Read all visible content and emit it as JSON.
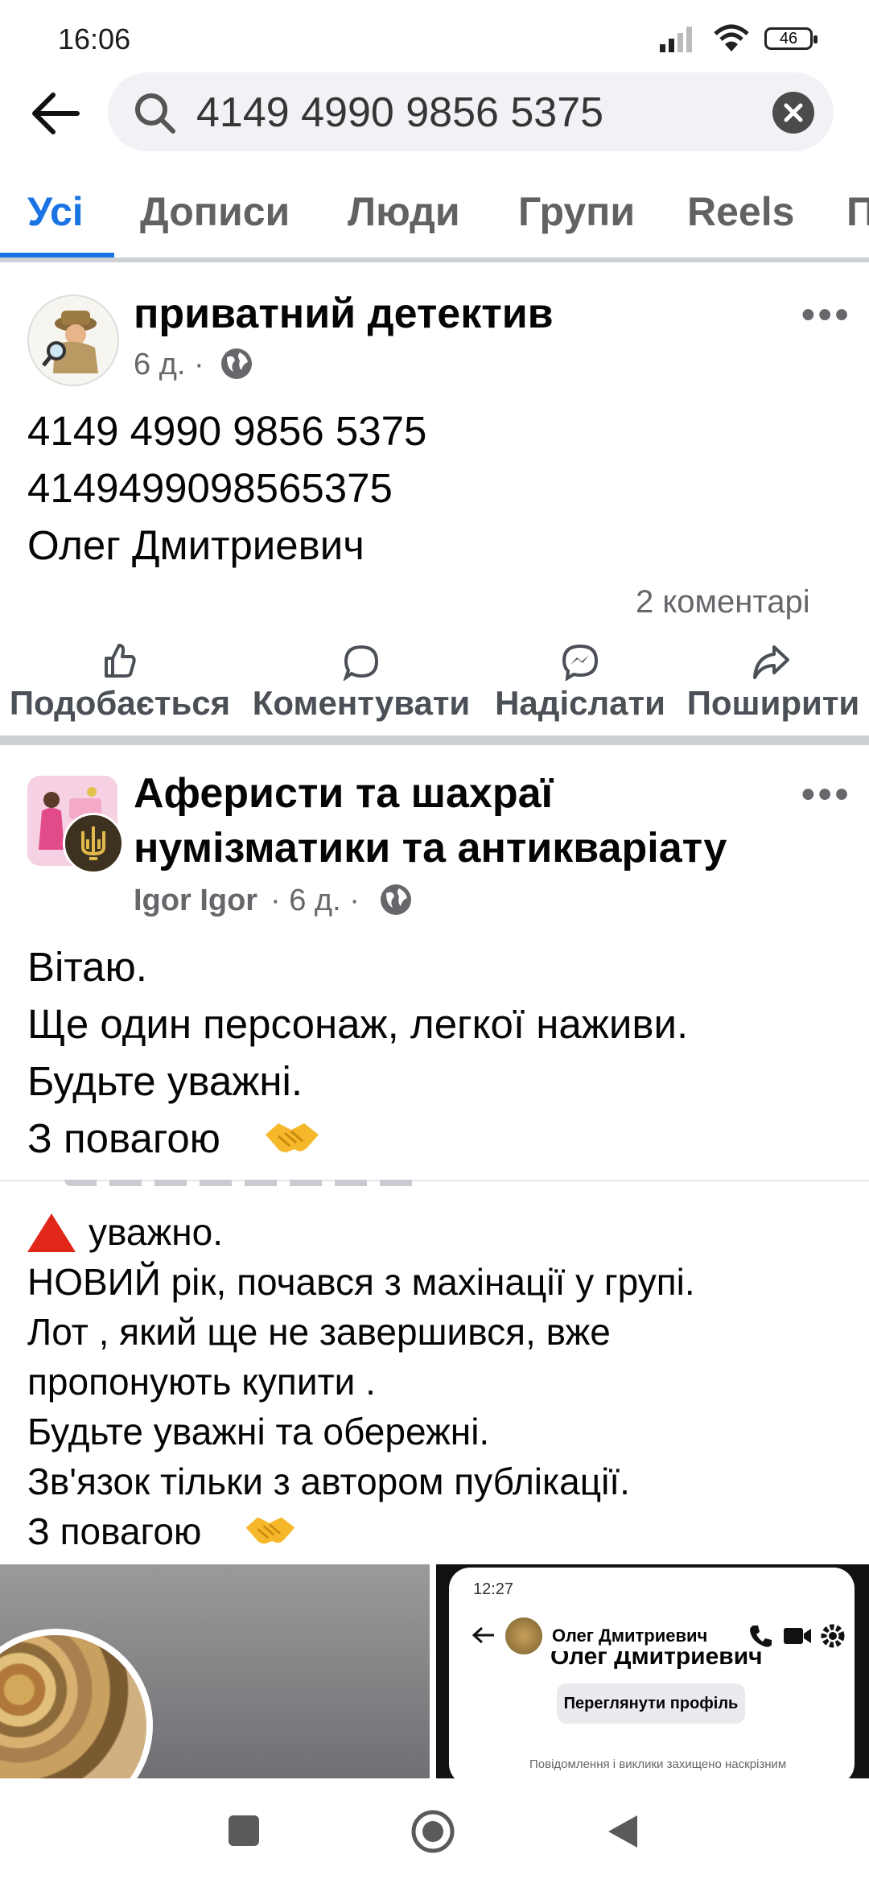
{
  "status": {
    "time": "16:06",
    "battery": "46"
  },
  "search": {
    "query": "4149 4990 9856 5375"
  },
  "tabs": [
    "Усі",
    "Дописи",
    "Люди",
    "Групи",
    "Reels",
    "П"
  ],
  "post1": {
    "author": "приватний детектив",
    "meta": "6 д. ·",
    "lines": [
      "4149 4990 9856 5375",
      "4149499098565375",
      "Олег Дмитриевич"
    ],
    "comments": "2 коментарі",
    "actions": [
      "Подобається",
      "Коментувати",
      "Надіслати",
      "Поширити"
    ]
  },
  "post2": {
    "group": [
      "Аферисти та шахраї",
      "нумізматики та антикваріату"
    ],
    "author": "Igor Igor",
    "meta": "· 6 д. ·",
    "lines": [
      "Вітаю.",
      "Ще один персонаж, легкої наживи.",
      "Будьте уважні.",
      "З повагою"
    ],
    "shared_lines": [
      "уважно.",
      "НОВИЙ рік, почався з махінації у групі.",
      "Лот , який ще не завершився, вже",
      "пропонують купити .",
      "Будьте уважні та обережні.",
      "Зв'язок тільки з автором публікації.",
      "З повагою"
    ]
  },
  "screenshot": {
    "time": "12:27",
    "contact": "Олег Дмитриевич",
    "contact_cut": "Олег Дмитриевич",
    "button": "Переглянути профіль",
    "note": "Повідомлення і виклики захищено наскрізним"
  },
  "colors": {
    "accent": "#1b74e4",
    "secondary": "#65676b"
  }
}
